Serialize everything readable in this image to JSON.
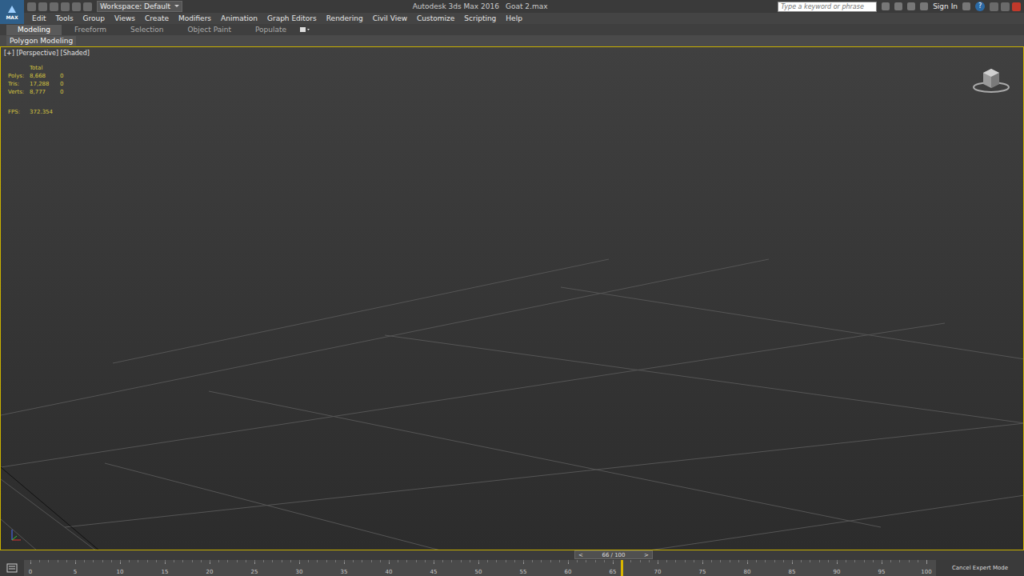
{
  "window": {
    "title": "Autodesk 3ds Max 2016",
    "file": "Goat 2.max"
  },
  "app_logo": "MAX",
  "workspace": "Workspace: Default",
  "search": {
    "placeholder": "Type a keyword or phrase"
  },
  "sign_in": "Sign In",
  "help": "?",
  "menu": [
    "Edit",
    "Tools",
    "Group",
    "Views",
    "Create",
    "Modifiers",
    "Animation",
    "Graph Editors",
    "Rendering",
    "Civil View",
    "Customize",
    "Scripting",
    "Help"
  ],
  "ribbon_tabs": [
    {
      "label": "Modeling",
      "selected": true
    },
    {
      "label": "Freeform",
      "selected": false
    },
    {
      "label": "Selection",
      "selected": false
    },
    {
      "label": "Object Paint",
      "selected": false
    },
    {
      "label": "Populate",
      "selected": false
    }
  ],
  "ribbon_panel": "Polygon Modeling",
  "viewport": {
    "label": "[+] [Perspective] [Shaded]",
    "stats_header": "Total",
    "stats": [
      {
        "label": "Polys:",
        "value": "8,668",
        "selected_value": "0"
      },
      {
        "label": "Tris:",
        "value": "17,288",
        "selected_value": "0"
      },
      {
        "label": "Verts:",
        "value": "8,777",
        "selected_value": "0"
      }
    ],
    "fps_label": "FPS:",
    "fps": "372.354"
  },
  "time_slider": {
    "prev": "<",
    "next": ">",
    "reading": "66 / 100",
    "level": 0.66
  },
  "track_ticks": [
    "0",
    "5",
    "10",
    "15",
    "20",
    "25",
    "30",
    "35",
    "40",
    "45",
    "50",
    "55",
    "60",
    "65",
    "70",
    "75",
    "80",
    "85",
    "90",
    "95",
    "100"
  ],
  "expert_mode": "Cancel Expert Mode"
}
